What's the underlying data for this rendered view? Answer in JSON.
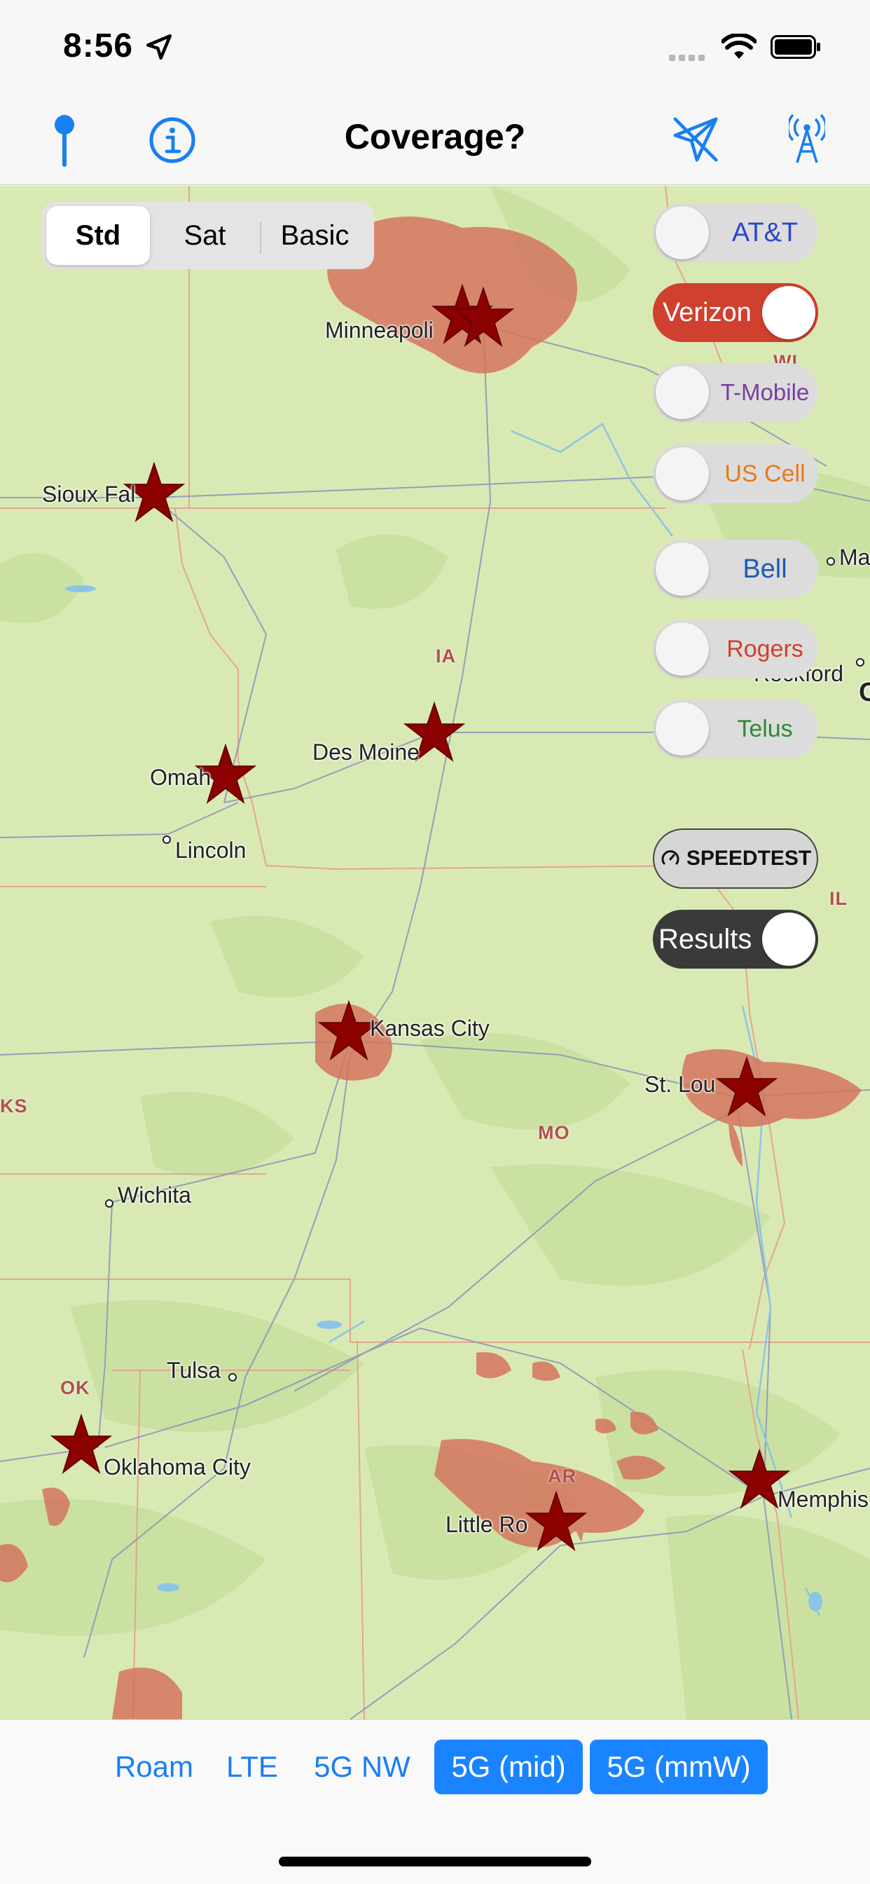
{
  "status_bar": {
    "time": "8:56",
    "location_icon": "location-arrow-icon",
    "wifi_icon": "wifi-icon",
    "battery_icon": "battery-icon"
  },
  "nav": {
    "title": "Coverage?",
    "left_icons": [
      "pin-icon",
      "info-icon"
    ],
    "right_icons": [
      "airplane-icon",
      "cell-tower-icon"
    ],
    "accent_color": "#1a7ff0"
  },
  "map_types": {
    "options": [
      "Std",
      "Sat",
      "Basic"
    ],
    "selected": "Std"
  },
  "carriers": [
    {
      "label": "AT&T",
      "on": false,
      "color": "#2b47c9"
    },
    {
      "label": "Verizon",
      "on": true,
      "color": "#d0402e"
    },
    {
      "label": "T-Mobile",
      "on": false,
      "color": "#7b3e9e"
    },
    {
      "label": "US Cell",
      "on": false,
      "color": "#e87a18"
    },
    {
      "label": "Bell",
      "on": false,
      "color": "#1f5bb0"
    },
    {
      "label": "Rogers",
      "on": false,
      "color": "#d0402e"
    },
    {
      "label": "Telus",
      "on": false,
      "color": "#2f8a32"
    }
  ],
  "speedtest": {
    "label": "SPEEDTEST",
    "icon": "speedometer-icon"
  },
  "results": {
    "label": "Results",
    "on": true
  },
  "map": {
    "cities": [
      "Minneapolis",
      "Sioux Falls",
      "Des Moines",
      "Omaha",
      "Lincoln",
      "Kansas City",
      "St. Louis",
      "Wichita",
      "Tulsa",
      "Oklahoma City",
      "Little Rock",
      "Memphis",
      "Rockford",
      "Ma"
    ],
    "city_display": {
      "minneapolis": "Minneapoli",
      "sioux_falls": "Sioux Fal",
      "des_moines": "Des Moine",
      "omaha": "Omah",
      "lincoln": "Lincoln",
      "kansas_city": "Kansas City",
      "st_louis": "St. Lou",
      "wichita": "Wichita",
      "tulsa": "Tulsa",
      "oklahoma_city": "Oklahoma City",
      "little_rock": "Little Ro",
      "memphis": "Memphis",
      "rockford": "Rockford",
      "ma": "Ma",
      "c_partial": "C"
    },
    "states": {
      "wi": "WI",
      "ia": "IA",
      "il": "IL",
      "ks": "KS",
      "mo": "MO",
      "ok": "OK",
      "ar": "AR"
    },
    "coverage_color": "#d4745e",
    "marker_color": "#8b0000",
    "marker_icon": "star-marker-icon"
  },
  "network_types": {
    "options": [
      "Roam",
      "LTE",
      "5G NW",
      "5G (mid)",
      "5G (mmW)"
    ],
    "selected": [
      "5G (mid)",
      "5G (mmW)"
    ]
  }
}
